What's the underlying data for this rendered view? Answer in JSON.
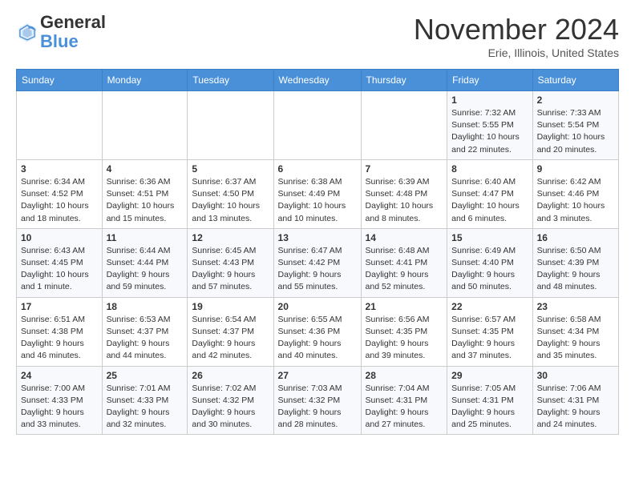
{
  "logo": {
    "general": "General",
    "blue": "Blue"
  },
  "header": {
    "month": "November 2024",
    "location": "Erie, Illinois, United States"
  },
  "weekdays": [
    "Sunday",
    "Monday",
    "Tuesday",
    "Wednesday",
    "Thursday",
    "Friday",
    "Saturday"
  ],
  "weeks": [
    [
      {
        "day": "",
        "info": ""
      },
      {
        "day": "",
        "info": ""
      },
      {
        "day": "",
        "info": ""
      },
      {
        "day": "",
        "info": ""
      },
      {
        "day": "",
        "info": ""
      },
      {
        "day": "1",
        "info": "Sunrise: 7:32 AM\nSunset: 5:55 PM\nDaylight: 10 hours\nand 22 minutes."
      },
      {
        "day": "2",
        "info": "Sunrise: 7:33 AM\nSunset: 5:54 PM\nDaylight: 10 hours\nand 20 minutes."
      }
    ],
    [
      {
        "day": "3",
        "info": "Sunrise: 6:34 AM\nSunset: 4:52 PM\nDaylight: 10 hours\nand 18 minutes."
      },
      {
        "day": "4",
        "info": "Sunrise: 6:36 AM\nSunset: 4:51 PM\nDaylight: 10 hours\nand 15 minutes."
      },
      {
        "day": "5",
        "info": "Sunrise: 6:37 AM\nSunset: 4:50 PM\nDaylight: 10 hours\nand 13 minutes."
      },
      {
        "day": "6",
        "info": "Sunrise: 6:38 AM\nSunset: 4:49 PM\nDaylight: 10 hours\nand 10 minutes."
      },
      {
        "day": "7",
        "info": "Sunrise: 6:39 AM\nSunset: 4:48 PM\nDaylight: 10 hours\nand 8 minutes."
      },
      {
        "day": "8",
        "info": "Sunrise: 6:40 AM\nSunset: 4:47 PM\nDaylight: 10 hours\nand 6 minutes."
      },
      {
        "day": "9",
        "info": "Sunrise: 6:42 AM\nSunset: 4:46 PM\nDaylight: 10 hours\nand 3 minutes."
      }
    ],
    [
      {
        "day": "10",
        "info": "Sunrise: 6:43 AM\nSunset: 4:45 PM\nDaylight: 10 hours\nand 1 minute."
      },
      {
        "day": "11",
        "info": "Sunrise: 6:44 AM\nSunset: 4:44 PM\nDaylight: 9 hours\nand 59 minutes."
      },
      {
        "day": "12",
        "info": "Sunrise: 6:45 AM\nSunset: 4:43 PM\nDaylight: 9 hours\nand 57 minutes."
      },
      {
        "day": "13",
        "info": "Sunrise: 6:47 AM\nSunset: 4:42 PM\nDaylight: 9 hours\nand 55 minutes."
      },
      {
        "day": "14",
        "info": "Sunrise: 6:48 AM\nSunset: 4:41 PM\nDaylight: 9 hours\nand 52 minutes."
      },
      {
        "day": "15",
        "info": "Sunrise: 6:49 AM\nSunset: 4:40 PM\nDaylight: 9 hours\nand 50 minutes."
      },
      {
        "day": "16",
        "info": "Sunrise: 6:50 AM\nSunset: 4:39 PM\nDaylight: 9 hours\nand 48 minutes."
      }
    ],
    [
      {
        "day": "17",
        "info": "Sunrise: 6:51 AM\nSunset: 4:38 PM\nDaylight: 9 hours\nand 46 minutes."
      },
      {
        "day": "18",
        "info": "Sunrise: 6:53 AM\nSunset: 4:37 PM\nDaylight: 9 hours\nand 44 minutes."
      },
      {
        "day": "19",
        "info": "Sunrise: 6:54 AM\nSunset: 4:37 PM\nDaylight: 9 hours\nand 42 minutes."
      },
      {
        "day": "20",
        "info": "Sunrise: 6:55 AM\nSunset: 4:36 PM\nDaylight: 9 hours\nand 40 minutes."
      },
      {
        "day": "21",
        "info": "Sunrise: 6:56 AM\nSunset: 4:35 PM\nDaylight: 9 hours\nand 39 minutes."
      },
      {
        "day": "22",
        "info": "Sunrise: 6:57 AM\nSunset: 4:35 PM\nDaylight: 9 hours\nand 37 minutes."
      },
      {
        "day": "23",
        "info": "Sunrise: 6:58 AM\nSunset: 4:34 PM\nDaylight: 9 hours\nand 35 minutes."
      }
    ],
    [
      {
        "day": "24",
        "info": "Sunrise: 7:00 AM\nSunset: 4:33 PM\nDaylight: 9 hours\nand 33 minutes."
      },
      {
        "day": "25",
        "info": "Sunrise: 7:01 AM\nSunset: 4:33 PM\nDaylight: 9 hours\nand 32 minutes."
      },
      {
        "day": "26",
        "info": "Sunrise: 7:02 AM\nSunset: 4:32 PM\nDaylight: 9 hours\nand 30 minutes."
      },
      {
        "day": "27",
        "info": "Sunrise: 7:03 AM\nSunset: 4:32 PM\nDaylight: 9 hours\nand 28 minutes."
      },
      {
        "day": "28",
        "info": "Sunrise: 7:04 AM\nSunset: 4:31 PM\nDaylight: 9 hours\nand 27 minutes."
      },
      {
        "day": "29",
        "info": "Sunrise: 7:05 AM\nSunset: 4:31 PM\nDaylight: 9 hours\nand 25 minutes."
      },
      {
        "day": "30",
        "info": "Sunrise: 7:06 AM\nSunset: 4:31 PM\nDaylight: 9 hours\nand 24 minutes."
      }
    ]
  ]
}
